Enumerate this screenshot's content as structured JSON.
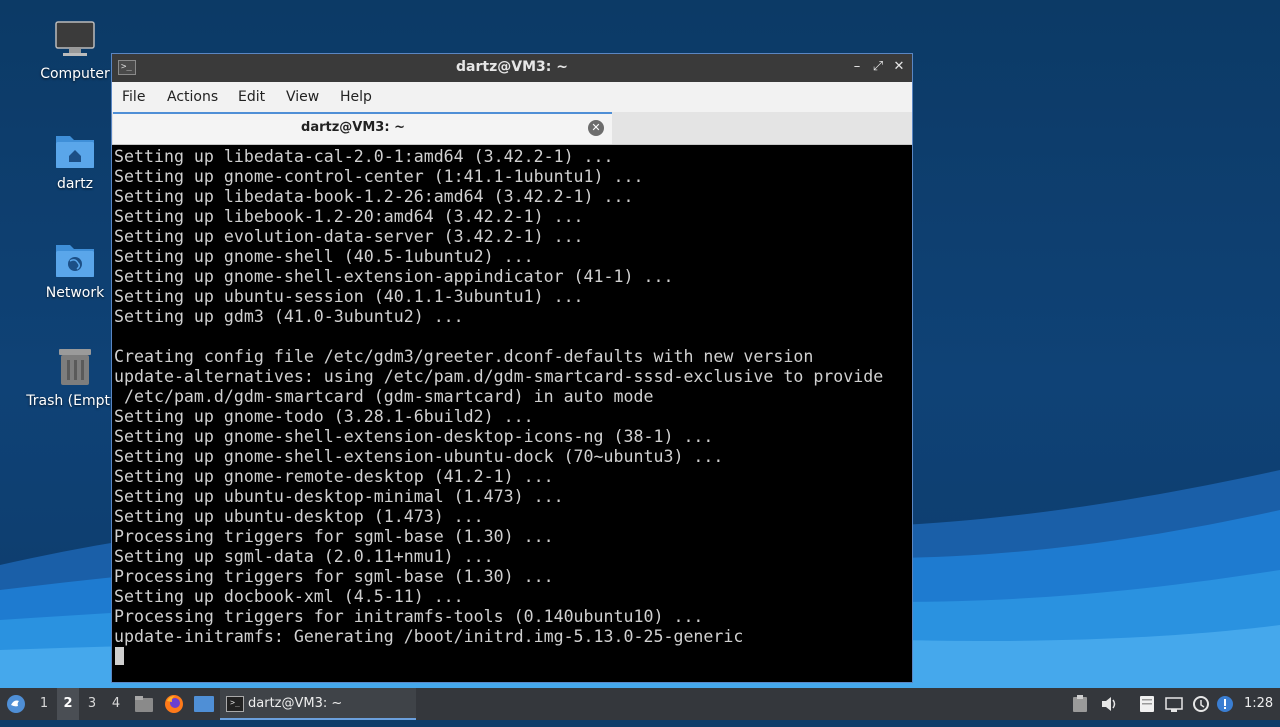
{
  "desktop": {
    "icons": [
      {
        "label": "Computer",
        "icon": "computer-icon"
      },
      {
        "label": "dartz",
        "icon": "home-folder-icon"
      },
      {
        "label": "Network",
        "icon": "network-folder-icon"
      },
      {
        "label": "Trash (Empty)",
        "icon": "trash-icon"
      }
    ]
  },
  "window": {
    "title": "dartz@VM3: ~",
    "menu": [
      "File",
      "Actions",
      "Edit",
      "View",
      "Help"
    ],
    "tab_label": "dartz@VM3: ~",
    "terminal_lines": [
      "Setting up libedata-cal-2.0-1:amd64 (3.42.2-1) ...",
      "Setting up gnome-control-center (1:41.1-1ubuntu1) ...",
      "Setting up libedata-book-1.2-26:amd64 (3.42.2-1) ...",
      "Setting up libebook-1.2-20:amd64 (3.42.2-1) ...",
      "Setting up evolution-data-server (3.42.2-1) ...",
      "Setting up gnome-shell (40.5-1ubuntu2) ...",
      "Setting up gnome-shell-extension-appindicator (41-1) ...",
      "Setting up ubuntu-session (40.1.1-3ubuntu1) ...",
      "Setting up gdm3 (41.0-3ubuntu2) ...",
      "",
      "Creating config file /etc/gdm3/greeter.dconf-defaults with new version",
      "update-alternatives: using /etc/pam.d/gdm-smartcard-sssd-exclusive to provide",
      " /etc/pam.d/gdm-smartcard (gdm-smartcard) in auto mode",
      "Setting up gnome-todo (3.28.1-6build2) ...",
      "Setting up gnome-shell-extension-desktop-icons-ng (38-1) ...",
      "Setting up gnome-shell-extension-ubuntu-dock (70~ubuntu3) ...",
      "Setting up gnome-remote-desktop (41.2-1) ...",
      "Setting up ubuntu-desktop-minimal (1.473) ...",
      "Setting up ubuntu-desktop (1.473) ...",
      "Processing triggers for sgml-base (1.30) ...",
      "Setting up sgml-data (2.0.11+nmu1) ...",
      "Processing triggers for sgml-base (1.30) ...",
      "Setting up docbook-xml (4.5-11) ...",
      "Processing triggers for initramfs-tools (0.140ubuntu10) ...",
      "update-initramfs: Generating /boot/initrd.img-5.13.0-25-generic"
    ]
  },
  "taskbar": {
    "workspaces": [
      "1",
      "2",
      "3",
      "4"
    ],
    "active_workspace": "2",
    "task_label": "dartz@VM3: ~",
    "clock": "1:28"
  },
  "colors": {
    "accent": "#4f8fd6",
    "desktop_bg": "#0c3a66",
    "terminal_bg": "#000000",
    "terminal_fg": "#d0d0d0"
  }
}
